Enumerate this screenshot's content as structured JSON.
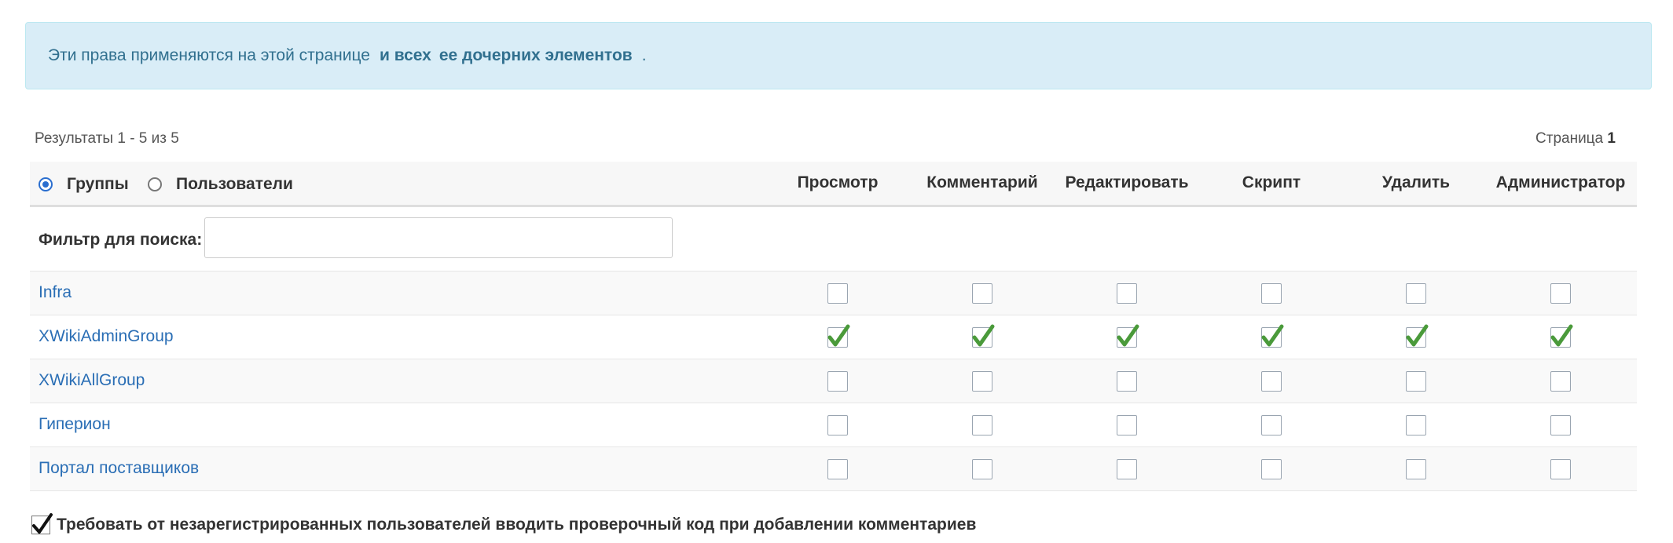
{
  "info": {
    "text": "Эти права применяются на этой странице",
    "strong1": "и всех",
    "strong2": "ее дочерних элементов",
    "dot": "."
  },
  "results": {
    "text": "Результаты 1 - 5 из 5"
  },
  "pager": {
    "label": "Страница",
    "page": "1"
  },
  "tabs": [
    {
      "label": "Группы",
      "selected": true
    },
    {
      "label": "Пользователи",
      "selected": false
    }
  ],
  "columns": [
    "Просмотр",
    "Комментарий",
    "Редактировать",
    "Скрипт",
    "Удалить",
    "Администратор"
  ],
  "filter": {
    "label": "Фильтр для поиска:",
    "value": ""
  },
  "rows": [
    {
      "name": "Infra",
      "rights": [
        false,
        false,
        false,
        false,
        false,
        false
      ]
    },
    {
      "name": "XWikiAdminGroup",
      "rights": [
        true,
        true,
        true,
        true,
        true,
        true
      ]
    },
    {
      "name": "XWikiAllGroup",
      "rights": [
        false,
        false,
        false,
        false,
        false,
        false
      ]
    },
    {
      "name": "Гиперион",
      "rights": [
        false,
        false,
        false,
        false,
        false,
        false
      ]
    },
    {
      "name": "Портал поставщиков",
      "rights": [
        false,
        false,
        false,
        false,
        false,
        false
      ]
    }
  ],
  "captcha": {
    "label": "Требовать от незарегистрированных пользователей вводить проверочный код при добавлении комментариев",
    "checked": true
  },
  "colors": {
    "accent": "#2a6eb5",
    "check_green": "#4a9a3a",
    "info_bg": "#d9edf7",
    "info_text": "#31708f"
  }
}
